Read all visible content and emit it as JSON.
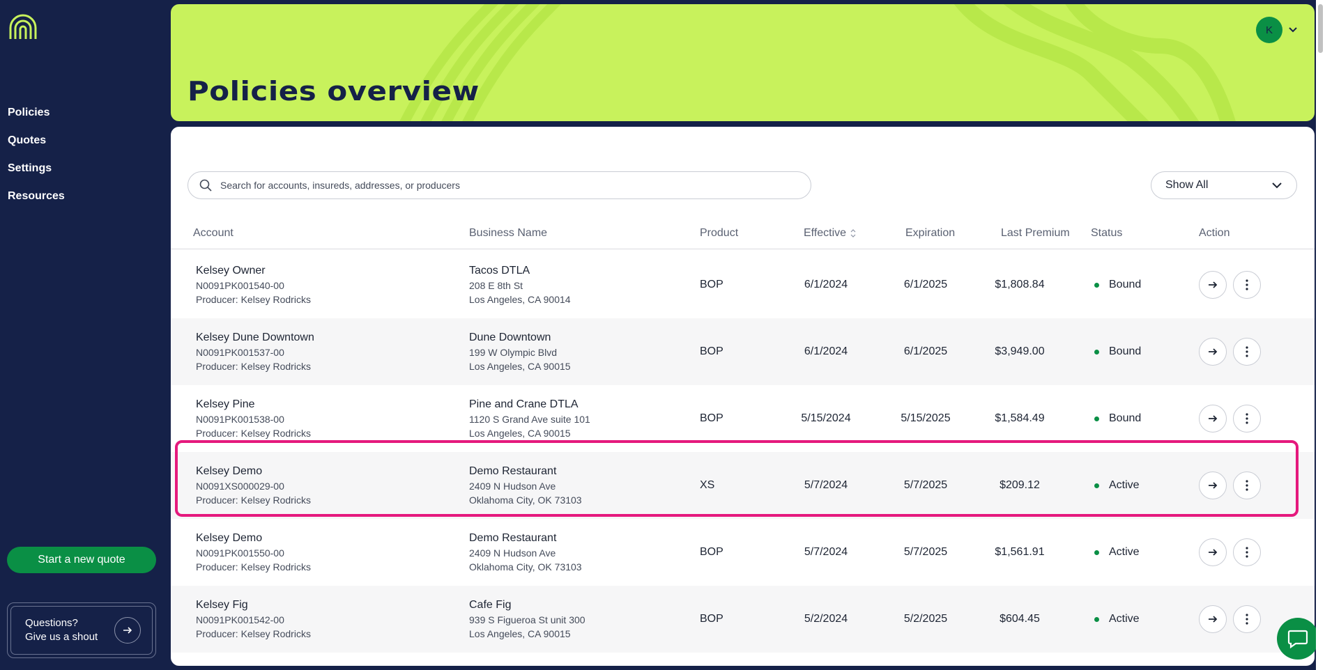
{
  "sidebar": {
    "nav": [
      {
        "label": "Policies"
      },
      {
        "label": "Quotes"
      },
      {
        "label": "Settings"
      },
      {
        "label": "Resources"
      }
    ],
    "cta_label": "Start a new quote",
    "help": {
      "line1": "Questions?",
      "line2": "Give us a shout"
    }
  },
  "header": {
    "title": "Policies overview",
    "avatar_initial": "K"
  },
  "search": {
    "placeholder": "Search for accounts, insureds, addresses, or producers"
  },
  "filter": {
    "selected": "Show All"
  },
  "table": {
    "columns": [
      "Account",
      "Business Name",
      "Product",
      "Effective",
      "Expiration",
      "Last Premium",
      "Status",
      "Action"
    ],
    "rows": [
      {
        "account": "Kelsey Owner",
        "policy": "N0091PK001540-00",
        "producer": "Producer: Kelsey Rodricks",
        "business": "Tacos DTLA",
        "addr1": "208 E 8th St",
        "addr2": "Los Angeles, CA 90014",
        "product": "BOP",
        "effective": "6/1/2024",
        "expiration": "6/1/2025",
        "premium": "$1,808.84",
        "status": "Bound"
      },
      {
        "account": "Kelsey Dune Downtown",
        "policy": "N0091PK001537-00",
        "producer": "Producer: Kelsey Rodricks",
        "business": "Dune Downtown",
        "addr1": "199 W Olympic Blvd",
        "addr2": "Los Angeles, CA 90015",
        "product": "BOP",
        "effective": "6/1/2024",
        "expiration": "6/1/2025",
        "premium": "$3,949.00",
        "status": "Bound"
      },
      {
        "account": "Kelsey Pine",
        "policy": "N0091PK001538-00",
        "producer": "Producer: Kelsey Rodricks",
        "business": "Pine and Crane DTLA",
        "addr1": "1120 S Grand Ave suite 101",
        "addr2": "Los Angeles, CA 90015",
        "product": "BOP",
        "effective": "5/15/2024",
        "expiration": "5/15/2025",
        "premium": "$1,584.49",
        "status": "Bound"
      },
      {
        "account": "Kelsey Demo",
        "policy": "N0091XS000029-00",
        "producer": "Producer: Kelsey Rodricks",
        "business": "Demo Restaurant",
        "addr1": "2409 N Hudson Ave",
        "addr2": "Oklahoma City, OK 73103",
        "product": "XS",
        "effective": "5/7/2024",
        "expiration": "5/7/2025",
        "premium": "$209.12",
        "status": "Active"
      },
      {
        "account": "Kelsey Demo",
        "policy": "N0091PK001550-00",
        "producer": "Producer: Kelsey Rodricks",
        "business": "Demo Restaurant",
        "addr1": "2409 N Hudson Ave",
        "addr2": "Oklahoma City, OK 73103",
        "product": "BOP",
        "effective": "5/7/2024",
        "expiration": "5/7/2025",
        "premium": "$1,561.91",
        "status": "Active"
      },
      {
        "account": "Kelsey Fig",
        "policy": "N0091PK001542-00",
        "producer": "Producer: Kelsey Rodricks",
        "business": "Cafe Fig",
        "addr1": "939 S Figueroa St unit 300",
        "addr2": "Los Angeles, CA 90015",
        "product": "BOP",
        "effective": "5/2/2024",
        "expiration": "5/2/2025",
        "premium": "$604.45",
        "status": "Active"
      }
    ]
  },
  "colors": {
    "navy": "#152148",
    "lime": "#c8f25c",
    "green": "#0a8f45",
    "highlight": "#e5197d"
  },
  "icons": {
    "logo": "rainbow-arch-logo",
    "search": "search-icon",
    "dropdown": "chevron-down-icon",
    "sort": "sort-icon",
    "row_open": "arrow-right-icon",
    "row_menu": "more-vertical-icon",
    "chat": "chat-bubble-icon"
  }
}
